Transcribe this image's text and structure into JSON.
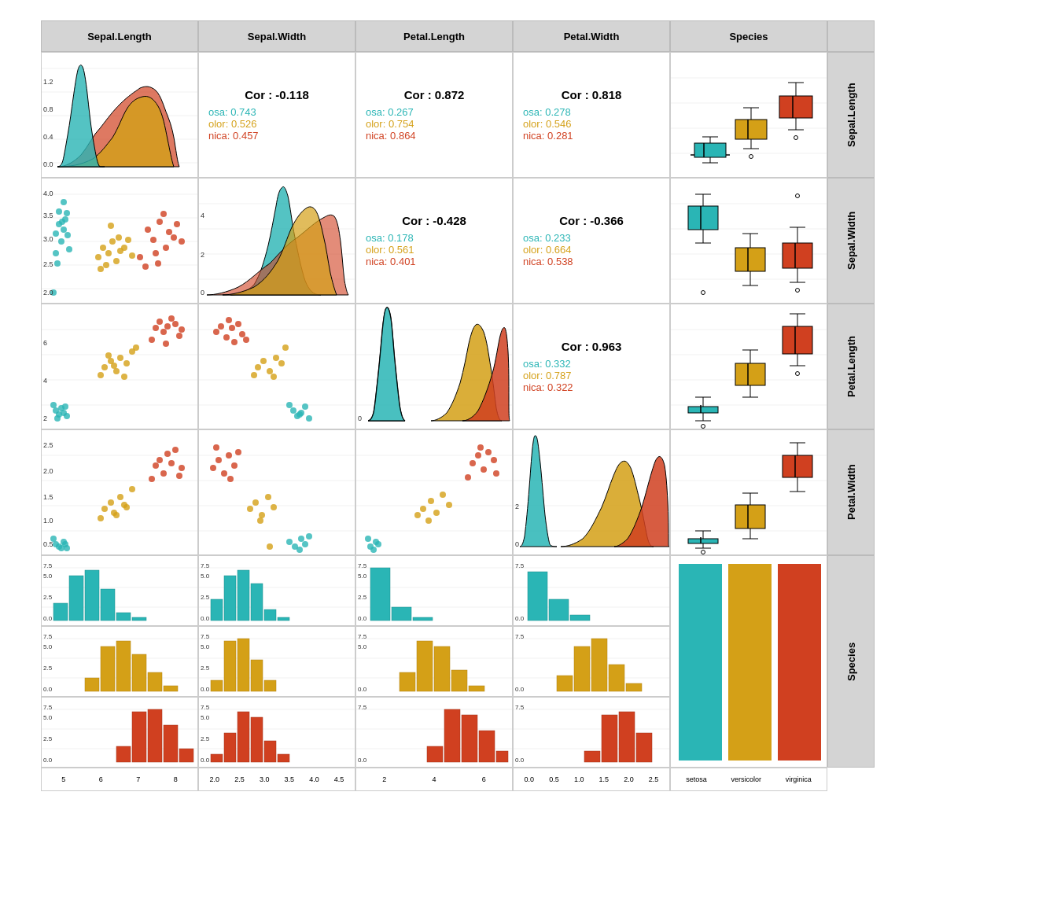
{
  "headers": [
    "Sepal.Length",
    "Sepal.Width",
    "Petal.Length",
    "Petal.Width",
    "Species"
  ],
  "row_labels": [
    "Sepal.Length",
    "Sepal.Width",
    "Petal.Length",
    "Petal.Width",
    "Species"
  ],
  "colors": {
    "setosa": "#2ab5b5",
    "versicolor": "#d4a017",
    "virginica": "#d04020",
    "bg": "#d4d4d4"
  },
  "correlations": {
    "r1c2": {
      "main": "Cor : -0.118",
      "setosa": "osa: 0.743",
      "versicolor": "olor: 0.526",
      "virginica": "nica: 0.457"
    },
    "r1c3": {
      "main": "Cor : 0.872",
      "setosa": "osa: 0.267",
      "versicolor": "olor: 0.754",
      "virginica": "nica: 0.864"
    },
    "r1c4": {
      "main": "Cor : 0.818",
      "setosa": "osa: 0.278",
      "versicolor": "olor: 0.546",
      "virginica": "nica: 0.281"
    },
    "r2c3": {
      "main": "Cor : -0.428",
      "setosa": "osa: 0.178",
      "versicolor": "olor: 0.561",
      "virginica": "nica: 0.401"
    },
    "r2c4": {
      "main": "Cor : -0.366",
      "setosa": "osa: 0.233",
      "versicolor": "olor: 0.664",
      "virginica": "nica: 0.538"
    },
    "r3c4": {
      "main": "Cor : 0.963",
      "setosa": "osa: 0.332",
      "versicolor": "olor: 0.787",
      "virginica": "nica: 0.322"
    }
  },
  "axis_labels": {
    "row1_bottom": [
      "5",
      "6",
      "7",
      "8"
    ],
    "row2_bottom": [
      "2.0",
      "2.5",
      "3.0",
      "3.5",
      "4.0",
      "4.5"
    ],
    "row3_bottom": [
      "2",
      "4",
      "6"
    ],
    "row4_bottom": [
      "0.0",
      "0.5",
      "1.0",
      "1.5",
      "2.0",
      "2.5"
    ],
    "species_names": [
      "setosa",
      "versicolor",
      "virginica"
    ]
  }
}
